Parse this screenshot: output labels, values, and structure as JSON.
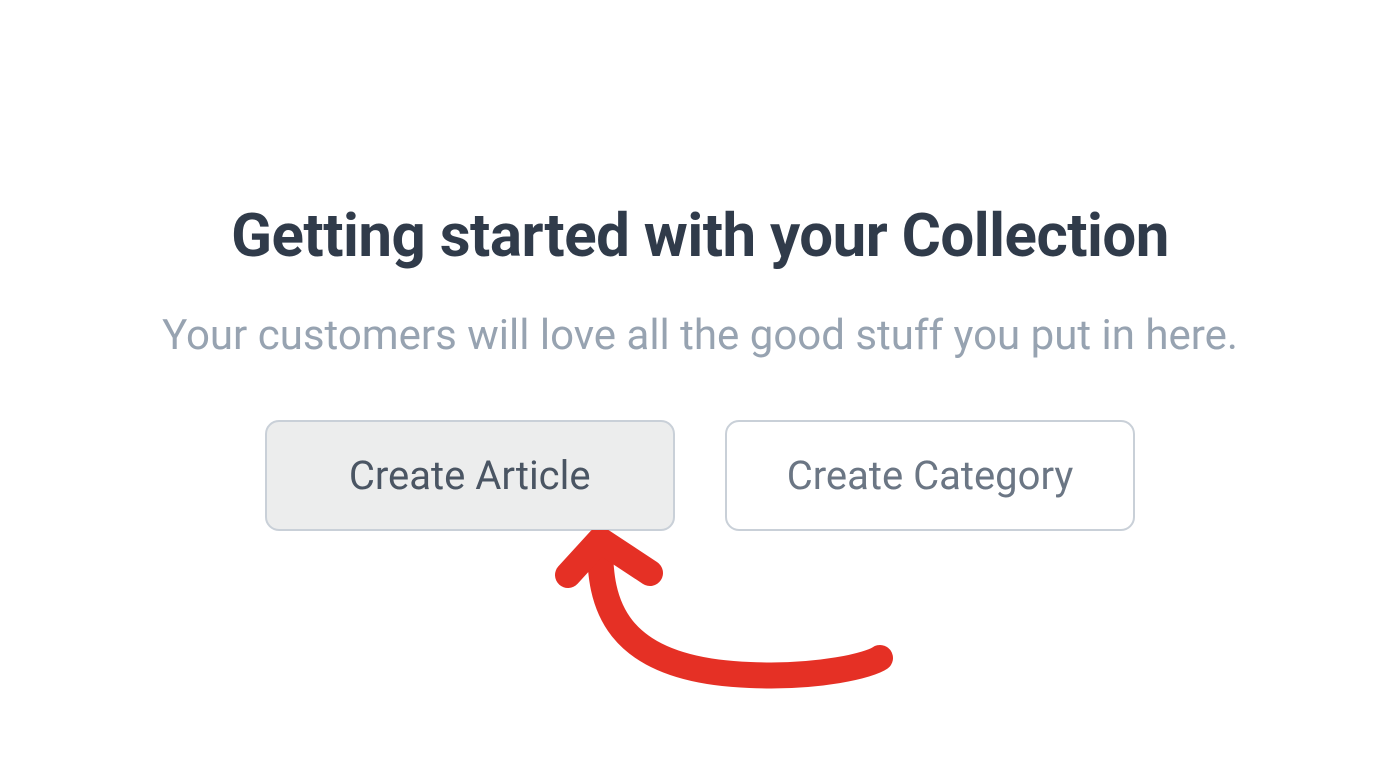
{
  "heading": "Getting started with your Collection",
  "subheading": "Your customers will love all the good stuff you put in here.",
  "buttons": {
    "create_article": "Create Article",
    "create_category": "Create Category"
  },
  "colors": {
    "heading": "#303b4a",
    "subheading": "#97a3b1",
    "button_border": "#c9d0d8",
    "button_primary_bg": "#eceded",
    "button_secondary_bg": "#ffffff",
    "annotation": "#e53025"
  }
}
